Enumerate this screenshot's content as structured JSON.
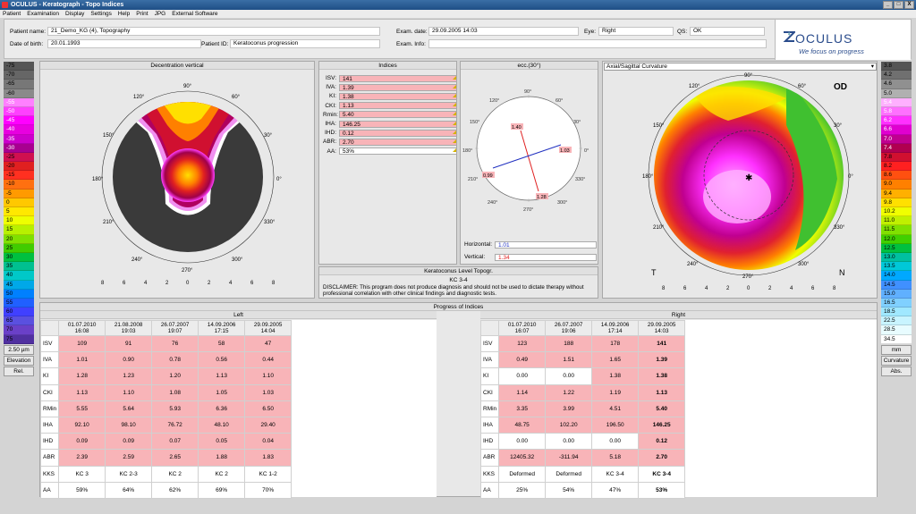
{
  "window": {
    "title": "OCULUS - Keratograph - Topo Indices",
    "controls": [
      "_",
      "□",
      "X"
    ]
  },
  "menu": [
    "Patient",
    "Examination",
    "Display",
    "Settings",
    "Help",
    "Print",
    "JPG",
    "External Software"
  ],
  "patient": {
    "name_label": "Patient name:",
    "name": "21_Demo_KG (4), Topography",
    "dob_label": "Date of birth:",
    "dob": "20.01.1993",
    "id_label": "Patient ID:",
    "id": "Keratoconus progression",
    "exam_date_label": "Exam. date:",
    "exam_date": "29.09.2005 14:03",
    "eye_label": "Eye:",
    "eye": "Right",
    "qs_label": "QS:",
    "qs": "OK",
    "exam_info_label": "Exam. Info:",
    "exam_info": ""
  },
  "logo": {
    "brand": "OCULUS",
    "slogan": "We focus on progress",
    "brand_color": "#2a4c8c"
  },
  "left_scale": {
    "values": [
      "-75",
      "-70",
      "-65",
      "-60",
      "-55",
      "-50",
      "-45",
      "-40",
      "-35",
      "-30",
      "-25",
      "-20",
      "-15",
      "-10",
      "-5",
      "0",
      "5",
      "10",
      "15",
      "20",
      "25",
      "30",
      "35",
      "40",
      "45",
      "50",
      "55",
      "60",
      "65",
      "70",
      "75"
    ],
    "colors": [
      "#555555",
      "#666666",
      "#777777",
      "#8a8a8a",
      "#ff80ff",
      "#ff40ff",
      "#ff00ff",
      "#e800e0",
      "#cc00cc",
      "#a80090",
      "#d01050",
      "#e02020",
      "#ff3020",
      "#ff7010",
      "#ff9a00",
      "#ffc800",
      "#ffe800",
      "#eeff00",
      "#b8f000",
      "#80e000",
      "#40cc00",
      "#00c040",
      "#00c090",
      "#00c8c8",
      "#00a8e8",
      "#0080ff",
      "#2060ff",
      "#4040ff",
      "#5a50e0",
      "#6a40c8",
      "#5030a0"
    ],
    "step": "2.50 µm",
    "mode": "Elevation",
    "ref": "Rel."
  },
  "right_scale": {
    "values": [
      "3.8",
      "4.2",
      "4.6",
      "5.0",
      "5.4",
      "5.8",
      "6.2",
      "6.6",
      "7.0",
      "7.4",
      "7.8",
      "8.2",
      "8.6",
      "9.0",
      "9.4",
      "9.8",
      "10.2",
      "11.0",
      "11.5",
      "12.0",
      "12.5",
      "13.0",
      "13.5",
      "14.0",
      "14.5",
      "15.0",
      "16.5",
      "18.5",
      "22.5",
      "28.5",
      "34.5"
    ],
    "colors": [
      "#555555",
      "#707070",
      "#909090",
      "#b0b0b0",
      "#ffb0ff",
      "#ff70ff",
      "#ff30ff",
      "#e000d0",
      "#c00090",
      "#b00050",
      "#d01030",
      "#ff2020",
      "#ff5010",
      "#ff8000",
      "#ffb000",
      "#ffe000",
      "#f0ff00",
      "#c0f000",
      "#80e000",
      "#40d000",
      "#00c040",
      "#00c0a0",
      "#00c8d8",
      "#00a8ff",
      "#4090ff",
      "#60b0ff",
      "#80d0ff",
      "#a0e8ff",
      "#c8f4ff",
      "#e8fcff",
      "#ffffff"
    ],
    "unit": "mm",
    "mode": "Curvature",
    "ref": "Abs."
  },
  "decentration": {
    "title": "Decentration vertical",
    "angles": {
      "top": "90°",
      "a60": "60°",
      "a120": "120°",
      "a30": "30°",
      "a150": "150°",
      "left": "180°",
      "right": "0°",
      "a210": "210°",
      "a330": "330°",
      "a240": "240°",
      "a300": "300°",
      "bottom": "270°"
    },
    "x_ticks": [
      "8",
      "6",
      "4",
      "2",
      "0",
      "2",
      "4",
      "6",
      "8"
    ]
  },
  "indices": {
    "title": "Indices",
    "rows": [
      {
        "label": "ISV:",
        "value": "141",
        "hl": true
      },
      {
        "label": "IVA:",
        "value": "1.39",
        "hl": true
      },
      {
        "label": "KI:",
        "value": "1.38",
        "hl": true
      },
      {
        "label": "CKI:",
        "value": "1.13",
        "hl": true
      },
      {
        "label": "Rmin:",
        "value": "5.40",
        "hl": true
      },
      {
        "label": "IHA:",
        "value": "146.25",
        "hl": true
      },
      {
        "label": "IHD:",
        "value": "0.12",
        "hl": true
      },
      {
        "label": "ABR:",
        "value": "2.70",
        "hl": true
      },
      {
        "label": "AA:",
        "value": "53%",
        "hl": false
      }
    ]
  },
  "ecc": {
    "title": "ecc.(30°)",
    "labels": {
      "top": "1.40",
      "right": "1.03",
      "left": "0.99",
      "bottom": "1.28"
    },
    "horizontal_label": "Horizontal:",
    "horizontal": "1.01",
    "vertical_label": "Vertical:",
    "vertical": "1.34"
  },
  "kc": {
    "title": "Keratoconus Level Topogr.",
    "level": "KC 3-4",
    "disclaimer": "DISCLAIMER: This program does not produce diagnosis and should not be used to dictate therapy without professional correlation with other clinical findings and diagnostic tests."
  },
  "axial": {
    "selector": "Axial/Sagittal Curvature",
    "od": "OD",
    "t": "T",
    "n": "N"
  },
  "progress": {
    "title": "Progress of Indices",
    "left_title": "Left",
    "right_title": "Right",
    "row_labels": [
      "ISV",
      "IVA",
      "KI",
      "CKI",
      "RMin",
      "IHA",
      "IHD",
      "ABR",
      "KKS",
      "AA"
    ],
    "left_dates": [
      [
        "01.07.2010",
        "16:08"
      ],
      [
        "21.08.2008",
        "19:03"
      ],
      [
        "26.07.2007",
        "19:07"
      ],
      [
        "14.09.2006",
        "17:15"
      ],
      [
        "29.09.2005",
        "14:04"
      ]
    ],
    "left_values": [
      [
        "109",
        "91",
        "76",
        "58",
        "47"
      ],
      [
        "1.01",
        "0.90",
        "0.78",
        "0.56",
        "0.44"
      ],
      [
        "1.28",
        "1.23",
        "1.20",
        "1.13",
        "1.10"
      ],
      [
        "1.13",
        "1.10",
        "1.08",
        "1.05",
        "1.03"
      ],
      [
        "5.55",
        "5.64",
        "5.93",
        "6.36",
        "6.50"
      ],
      [
        "92.10",
        "98.10",
        "76.72",
        "48.10",
        "29.40"
      ],
      [
        "0.09",
        "0.09",
        "0.07",
        "0.05",
        "0.04"
      ],
      [
        "2.39",
        "2.59",
        "2.65",
        "1.88",
        "1.83"
      ],
      [
        "KC 3",
        "KC 2-3",
        "KC 2",
        "KC 2",
        "KC 1-2"
      ],
      [
        "59%",
        "64%",
        "62%",
        "69%",
        "70%"
      ]
    ],
    "left_hl": [
      [
        1,
        1,
        1,
        1,
        1
      ],
      [
        1,
        1,
        1,
        1,
        1
      ],
      [
        1,
        1,
        1,
        1,
        1
      ],
      [
        1,
        1,
        1,
        1,
        1
      ],
      [
        1,
        1,
        1,
        1,
        1
      ],
      [
        1,
        1,
        1,
        1,
        1
      ],
      [
        1,
        1,
        1,
        1,
        1
      ],
      [
        1,
        1,
        1,
        1,
        1
      ],
      [
        0,
        0,
        0,
        0,
        0
      ],
      [
        0,
        0,
        0,
        0,
        0
      ]
    ],
    "right_dates": [
      [
        "01.07.2010",
        "16:07"
      ],
      [
        "26.07.2007",
        "19:06"
      ],
      [
        "14.09.2006",
        "17:14"
      ],
      [
        "29.09.2005",
        "14:03"
      ]
    ],
    "right_values": [
      [
        "123",
        "188",
        "178",
        "141"
      ],
      [
        "0.49",
        "1.51",
        "1.65",
        "1.39"
      ],
      [
        "0.00",
        "0.00",
        "1.38",
        "1.38"
      ],
      [
        "1.14",
        "1.22",
        "1.19",
        "1.13"
      ],
      [
        "3.35",
        "3.99",
        "4.51",
        "5.40"
      ],
      [
        "48.75",
        "102.20",
        "196.50",
        "146.25"
      ],
      [
        "0.00",
        "0.00",
        "0.00",
        "0.12"
      ],
      [
        "12405.32",
        "-311.94",
        "5.18",
        "2.70"
      ],
      [
        "Deformed",
        "Deformed",
        "KC 3-4",
        "KC 3-4"
      ],
      [
        "25%",
        "54%",
        "47%",
        "53%"
      ]
    ],
    "right_hl": [
      [
        1,
        1,
        1,
        1
      ],
      [
        1,
        1,
        1,
        1
      ],
      [
        0,
        0,
        1,
        1
      ],
      [
        1,
        1,
        1,
        1
      ],
      [
        1,
        1,
        1,
        1
      ],
      [
        1,
        1,
        1,
        1
      ],
      [
        0,
        0,
        0,
        1
      ],
      [
        1,
        1,
        1,
        1
      ],
      [
        0,
        0,
        0,
        0
      ],
      [
        0,
        0,
        0,
        0
      ]
    ]
  }
}
